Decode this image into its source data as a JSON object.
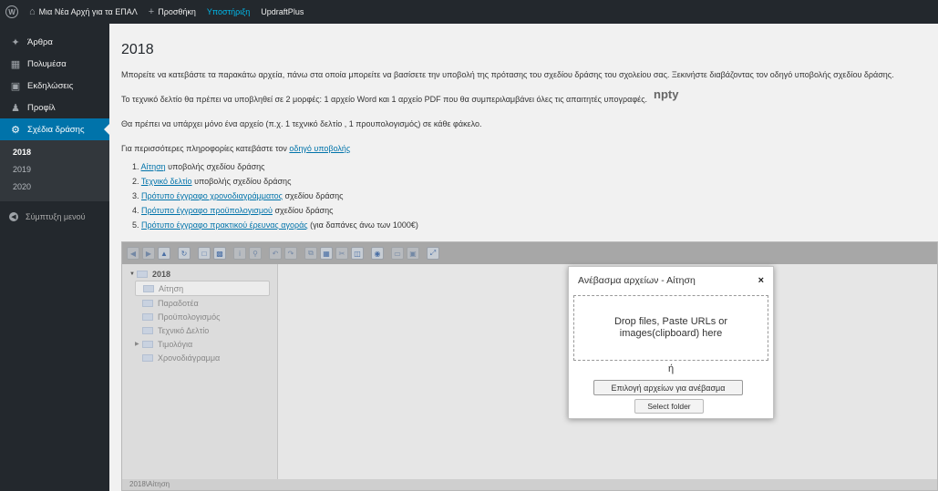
{
  "adminbar": {
    "site_name": "Μια Νέα Αρχή για τα ΕΠΑΛ",
    "new_label": "Προσθήκη",
    "support_label": "Υποστήριξη",
    "updraft_label": "UpdraftPlus",
    "icons": [
      "wordpress-logo",
      "home-icon",
      "plus-icon"
    ]
  },
  "sidebar": {
    "items": [
      {
        "label": "Άρθρα",
        "icon": "pin-icon"
      },
      {
        "label": "Πολυμέσα",
        "icon": "media-icon"
      },
      {
        "label": "Εκδηλώσεις",
        "icon": "calendar-icon"
      },
      {
        "label": "Προφίλ",
        "icon": "user-icon"
      },
      {
        "label": "Σχέδια δράσης",
        "icon": "gear-icon"
      }
    ],
    "submenu": [
      "2018",
      "2019",
      "2020"
    ],
    "collapse_label": "Σύμπτυξη μενού"
  },
  "main": {
    "title": "2018",
    "para1": "Μπορείτε να κατεβάστε τα παρακάτω αρχεία, πάνω στα οποία μπορείτε να βασίσετε την υποβολή της πρότασης του σχεδίου δράσης του σχολείου σας. Ξεκινήστε διαβάζοντας τον οδηγό υποβολής σχεδίου δράσης.",
    "para2": "Το τεχνικό δελτίο θα πρέπει να υποβληθεί σε 2 μορφές: 1 αρχείο Word και 1 αρχείο PDF που θα συμπεριλαμβάνει όλες τις απαιτητές υπογραφές.",
    "para3": "Θα πρέπει να υπάρχει μόνο ένα αρχείο (π.χ. 1 τεχνικό δελτίο , 1 προυπολογισμός) σε κάθε φάκελο.",
    "info_prefix": "Για περισσότερες πληροφορίες κατεβάστε τον ",
    "info_link": "οδηγό υποβολής",
    "docs": [
      {
        "num": "1. ",
        "link": "Αίτηση",
        "rest": " υποβολής σχεδίου δράσης"
      },
      {
        "num": "2. ",
        "link": "Τεχνικό δελτίο",
        "rest": " υποβολής σχεδίου δράσης"
      },
      {
        "num": "3. ",
        "link": "Πρότυπο έγγραφο χρονοδιαγράμματος",
        "rest": " σχεδίου δράσης"
      },
      {
        "num": "4. ",
        "link": "Πρότυπο έγγραφο προϋπολογισμού",
        "rest": " σχεδίου δράσης"
      },
      {
        "num": "5. ",
        "link": "Πρότυπο έγγραφο πρακτικού έρευνας αγοράς",
        "rest": " (για δαπάνες άνω των 1000€)"
      }
    ]
  },
  "file_manager": {
    "tree_root": "2018",
    "folders": [
      "Αίτηση",
      "Παραδοτέα",
      "Προϋπολογισμός",
      "Τεχνικό Δελτίο",
      "Τιμολόγια",
      "Χρονοδιάγραμμα"
    ],
    "selected_folder": "Αίτηση",
    "empty_text": "npty",
    "status_path": "2018\\Αίτηση"
  },
  "upload_dialog": {
    "title": "Ανέβασμα αρχείων - Αίτηση",
    "close_symbol": "×",
    "drop_text": "Drop files, Paste URLs or images(clipboard) here",
    "or_text": "ή",
    "choose_button": "Επιλογή αρχείων για ανέβασμα",
    "folder_button": "Select folder"
  },
  "colors": {
    "admin_bg": "#23282d",
    "accent": "#0073aa",
    "active_link": "#00b9eb"
  }
}
